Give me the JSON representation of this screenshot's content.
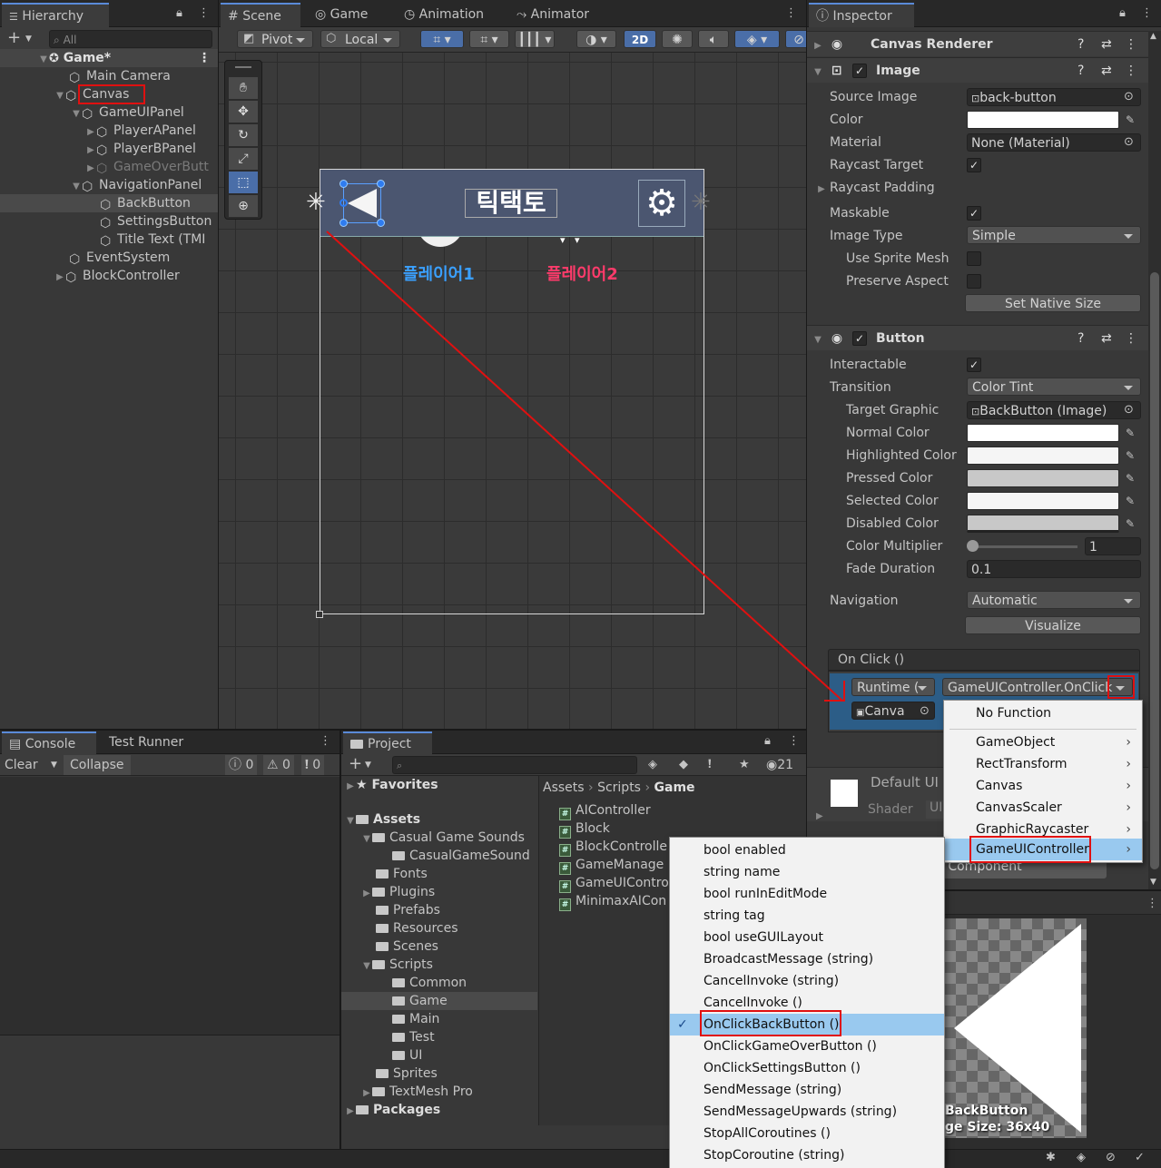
{
  "hierarchy": {
    "tab": "Hierarchy",
    "search_placeholder": "All",
    "scene": "Game*",
    "items": [
      {
        "label": "Main Camera"
      },
      {
        "label": "Canvas"
      },
      {
        "label": "GameUIPanel"
      },
      {
        "label": "PlayerAPanel"
      },
      {
        "label": "PlayerBPanel"
      },
      {
        "label": "GameOverButt"
      },
      {
        "label": "NavigationPanel"
      },
      {
        "label": "BackButton"
      },
      {
        "label": "SettingsButton"
      },
      {
        "label": "Title Text (TMI"
      },
      {
        "label": "EventSystem"
      },
      {
        "label": "BlockController"
      }
    ]
  },
  "scene_tabs": {
    "scene": "Scene",
    "game": "Game",
    "animation": "Animation",
    "animator": "Animator"
  },
  "scene_toolbar": {
    "pivot": "Pivot",
    "local": "Local",
    "mode2d": "2D"
  },
  "scene_view": {
    "title": "틱택토",
    "player1": "플레이어1",
    "player2": "플레이어2"
  },
  "inspector": {
    "tab": "Inspector",
    "canvas_renderer": "Canvas Renderer",
    "image": {
      "header": "Image",
      "source_image_label": "Source Image",
      "source_image": "back-button",
      "color_label": "Color",
      "material_label": "Material",
      "material": "None (Material)",
      "raycast_target_label": "Raycast Target",
      "raycast_padding_label": "Raycast Padding",
      "maskable_label": "Maskable",
      "image_type_label": "Image Type",
      "image_type": "Simple",
      "use_sprite_mesh_label": "Use Sprite Mesh",
      "preserve_aspect_label": "Preserve Aspect",
      "set_native_size": "Set Native Size"
    },
    "button": {
      "header": "Button",
      "interactable_label": "Interactable",
      "transition_label": "Transition",
      "transition": "Color Tint",
      "target_graphic_label": "Target Graphic",
      "target_graphic": "BackButton (Image)",
      "normal_color_label": "Normal Color",
      "highlighted_color_label": "Highlighted Color",
      "pressed_color_label": "Pressed Color",
      "selected_color_label": "Selected Color",
      "disabled_color_label": "Disabled Color",
      "color_multiplier_label": "Color Multiplier",
      "color_multiplier": "1",
      "fade_duration_label": "Fade Duration",
      "fade_duration": "0.1",
      "navigation_label": "Navigation",
      "navigation": "Automatic",
      "visualize": "Visualize",
      "on_click": "On Click ()",
      "runtime": "Runtime (",
      "function": "GameUIController.OnClick",
      "object": "Canva"
    },
    "default_ui": "Default UI",
    "shader_label": "Shader",
    "shader_value": "UI",
    "add_component_tail": "d Component",
    "preview_name": "BackButton",
    "preview_size": "ge Size: 36x40"
  },
  "console": {
    "tab": "Console",
    "test_runner": "Test Runner",
    "clear": "Clear",
    "collapse": "Collapse",
    "count_log": "0",
    "count_warn": "0",
    "count_err": "0"
  },
  "project": {
    "tab": "Project",
    "favorites": "Favorites",
    "assets": "Assets",
    "tree": [
      "Casual Game Sounds",
      "CasualGameSound",
      "Fonts",
      "Plugins",
      "Prefabs",
      "Resources",
      "Scenes",
      "Scripts",
      "Common",
      "Game",
      "Main",
      "Test",
      "UI",
      "Sprites",
      "TextMesh Pro"
    ],
    "packages": "Packages",
    "breadcrumb": [
      "Assets",
      "Scripts",
      "Game"
    ],
    "files": [
      "AIController",
      "Block",
      "BlockControlle",
      "GameManage",
      "GameUIContro",
      "MinimaxAICon"
    ],
    "count": "21"
  },
  "menu_components": {
    "items": [
      "No Function",
      "GameObject",
      "RectTransform",
      "Canvas",
      "CanvasScaler",
      "GraphicRaycaster",
      "GameUIController"
    ]
  },
  "menu_functions": {
    "items": [
      "bool enabled",
      "string name",
      "bool runInEditMode",
      "string tag",
      "bool useGUILayout",
      "BroadcastMessage (string)",
      "CancelInvoke (string)",
      "CancelInvoke ()",
      "OnClickBackButton ()",
      "OnClickGameOverButton ()",
      "OnClickSettingsButton ()",
      "SendMessage (string)",
      "SendMessageUpwards (string)",
      "StopAllCoroutines ()",
      "StopCoroutine (string)"
    ],
    "selected": "OnClickBackButton ()"
  },
  "colors": {
    "highlight_red": "#e01010",
    "selection_blue": "#2c5d87",
    "menu_selected": "#99c9ef",
    "player1": "#3aa0ff",
    "player2": "#ff3b6b",
    "arrow": "#e01010"
  }
}
